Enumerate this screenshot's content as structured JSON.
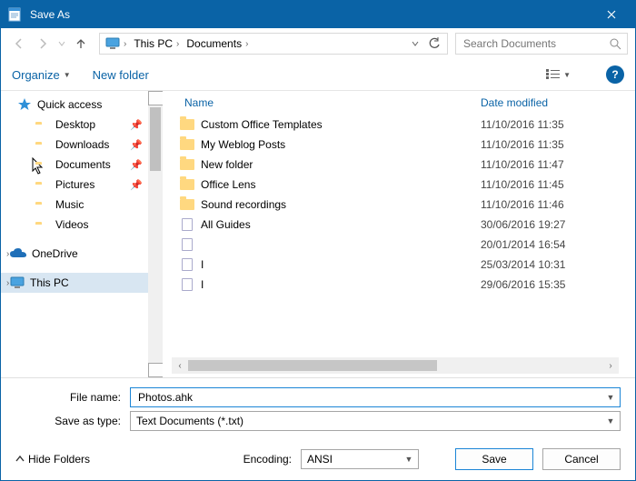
{
  "window": {
    "title": "Save As"
  },
  "nav": {
    "crumbs": [
      "This PC",
      "Documents"
    ],
    "search_placeholder": "Search Documents"
  },
  "toolbar": {
    "organize": "Organize",
    "newfolder": "New folder",
    "help": "?"
  },
  "sidebar": {
    "items": [
      {
        "label": "Quick access",
        "icon": "star",
        "level": 0
      },
      {
        "label": "Desktop",
        "icon": "folder",
        "level": 1,
        "pinned": true
      },
      {
        "label": "Downloads",
        "icon": "folder",
        "level": 1,
        "pinned": true
      },
      {
        "label": "Documents",
        "icon": "folder",
        "level": 1,
        "pinned": true
      },
      {
        "label": "Pictures",
        "icon": "folder",
        "level": 1,
        "pinned": true
      },
      {
        "label": "Music",
        "icon": "folder",
        "level": 1
      },
      {
        "label": "Videos",
        "icon": "folder",
        "level": 1
      },
      {
        "label": "OneDrive",
        "icon": "cloud",
        "level": 0
      },
      {
        "label": "This PC",
        "icon": "pc",
        "level": 0,
        "selected": true
      }
    ]
  },
  "columns": {
    "name": "Name",
    "date": "Date modified"
  },
  "files": [
    {
      "name": "Custom Office Templates",
      "kind": "folder",
      "date": "11/10/2016 11:35"
    },
    {
      "name": "My Weblog Posts",
      "kind": "folder",
      "date": "11/10/2016 11:35"
    },
    {
      "name": "New folder",
      "kind": "folder",
      "date": "11/10/2016 11:47"
    },
    {
      "name": "Office Lens",
      "kind": "folder",
      "date": "11/10/2016 11:45"
    },
    {
      "name": "Sound recordings",
      "kind": "folder",
      "date": "11/10/2016 11:46"
    },
    {
      "name": "All Guides",
      "kind": "file",
      "date": "30/06/2016 19:27"
    },
    {
      "name": "",
      "kind": "file",
      "date": "20/01/2014 16:54"
    },
    {
      "name": "I",
      "kind": "file",
      "date": "25/03/2014 10:31"
    },
    {
      "name": "I",
      "kind": "file",
      "date": "29/06/2016 15:35"
    }
  ],
  "form": {
    "filename_label": "File name:",
    "filename_value": "Photos.ahk",
    "type_label": "Save as type:",
    "type_value": "Text Documents (*.txt)"
  },
  "footer": {
    "hide": "Hide Folders",
    "encoding_label": "Encoding:",
    "encoding_value": "ANSI",
    "save": "Save",
    "cancel": "Cancel"
  }
}
